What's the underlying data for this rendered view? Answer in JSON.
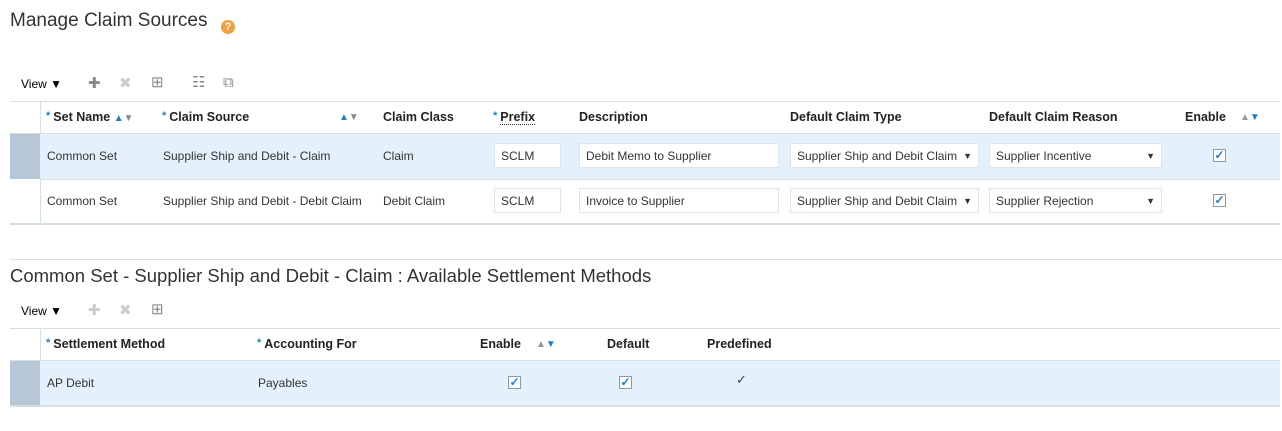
{
  "page": {
    "title": "Manage Claim Sources",
    "help_icon": "help-icon"
  },
  "toolbar1": {
    "view_label": "View ▼",
    "icons": [
      "add-icon",
      "delete-icon",
      "freeze-icon",
      "query-by-example-icon",
      "detach-icon"
    ]
  },
  "claim_sources": {
    "columns": [
      "Set Name",
      "Claim Source",
      "Claim Class",
      "Prefix",
      "Description",
      "Default Claim Type",
      "Default Claim Reason",
      "Enable"
    ],
    "required_mark": "*",
    "rows": [
      {
        "set_name": "Common Set",
        "claim_source": "Supplier Ship and Debit - Claim",
        "claim_class": "Claim",
        "prefix": "SCLM",
        "description": "Debit Memo to Supplier",
        "claim_type": "Supplier Ship and Debit Claim",
        "claim_reason": "Supplier Incentive",
        "enable": true,
        "selected": true
      },
      {
        "set_name": "Common Set",
        "claim_source": "Supplier Ship and Debit - Debit Claim",
        "claim_class": "Debit Claim",
        "prefix": "SCLM",
        "description": "Invoice to Supplier",
        "claim_type": "Supplier Ship and Debit Claim",
        "claim_reason": "Supplier Rejection",
        "enable": true,
        "selected": false
      }
    ]
  },
  "settlement": {
    "title": "Common Set - Supplier Ship and Debit - Claim : Available Settlement Methods",
    "view_label": "View ▼",
    "columns": [
      "Settlement Method",
      "Accounting For",
      "Enable",
      "Default",
      "Predefined"
    ],
    "rows": [
      {
        "method": "AP Debit",
        "accounting_for": "Payables",
        "enable": true,
        "default": true,
        "predefined": true
      }
    ]
  },
  "glyphs": {
    "check": "✓",
    "asc": "▲",
    "desc": "▼",
    "caret": "▼",
    "help": "?",
    "plus": "✚",
    "x": "✖",
    "grid": "⊞",
    "filter": "☷",
    "detach": "⧉"
  },
  "colors": {
    "accent": "#1e7ecb",
    "selected_row": "#e4f0fb",
    "help": "#f0a040"
  }
}
